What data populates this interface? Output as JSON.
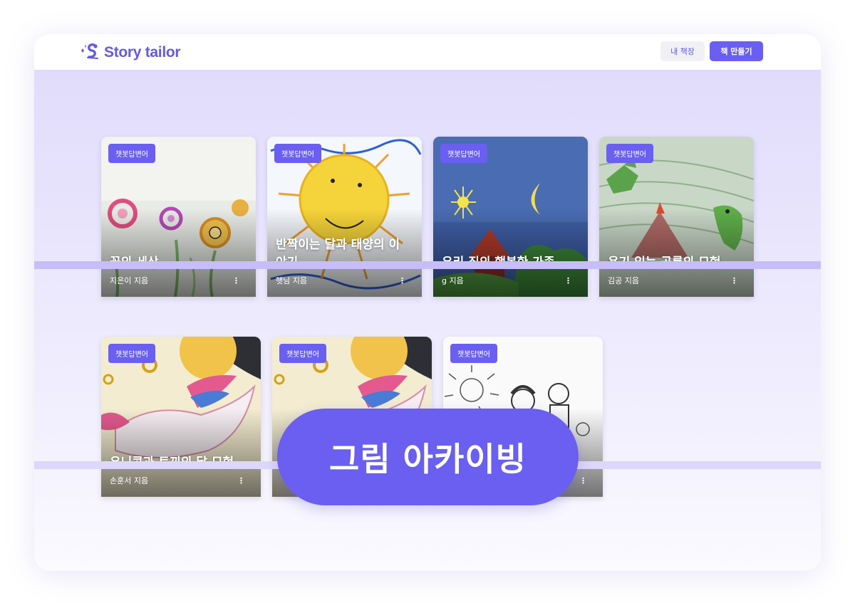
{
  "app": {
    "name": "Story tailor",
    "brand_color": "#6359e9"
  },
  "header": {
    "my_shelf_label": "내 책장",
    "make_book_label": "책 만들기"
  },
  "books": [
    {
      "badge": "챗봇답변어",
      "title": "꽃의 세상",
      "author": "지은이 지음",
      "art": "flowers-drawing"
    },
    {
      "badge": "챗봇답변어",
      "title": "반짝이는 달과 태양의 이야기",
      "author": "햇님 지음",
      "art": "sun-drawing"
    },
    {
      "badge": "챗봇답변어",
      "title": "우리 집의 행복한 가족",
      "author": "g 지음",
      "art": "night-house-drawing"
    },
    {
      "badge": "챗봇답변어",
      "title": "용기 있는 공룡의 모험",
      "author": "김공 지음",
      "art": "dinosaur-volcano-drawing"
    },
    {
      "badge": "챗봇답변어",
      "title": "유니콘과 토끼의 달 모험",
      "author": "손훈서 지음",
      "art": "unicorn-drawing"
    },
    {
      "badge": "챗봇답변어",
      "title": "",
      "author": "",
      "art": "unicorn-drawing"
    },
    {
      "badge": "챗봇답변어",
      "title": "",
      "author": "",
      "art": "family-sketch-drawing"
    }
  ],
  "overlay_banner": "그림 아카이빙",
  "more_glyph": "⋮"
}
